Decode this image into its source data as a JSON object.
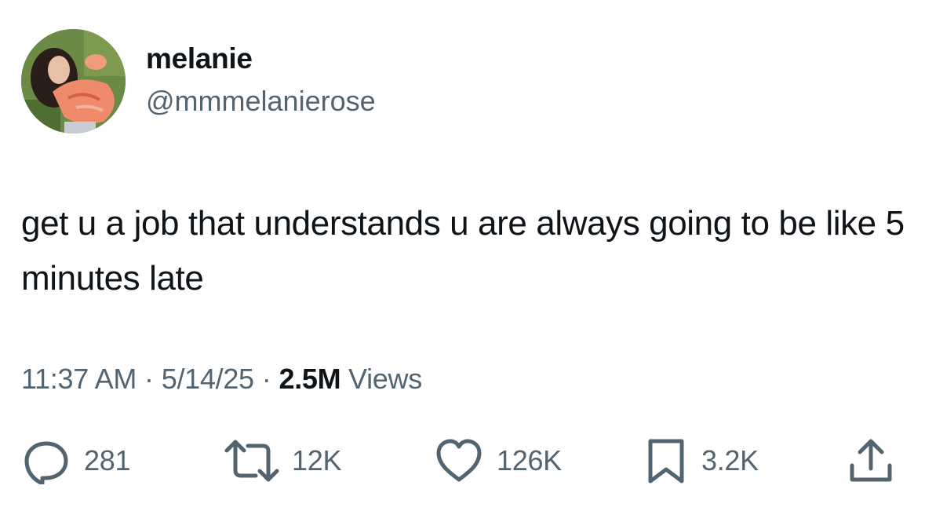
{
  "author": {
    "name": "melanie",
    "handle": "@mmmelanierose"
  },
  "tweet": {
    "text": "get u a job that understands u are always going to be like 5 minutes late"
  },
  "meta": {
    "time": "11:37 AM",
    "separator": "·",
    "date": "5/14/25",
    "views_count": "2.5M",
    "views_label": "Views"
  },
  "actions": {
    "replies": "281",
    "retweets": "12K",
    "likes": "126K",
    "bookmarks": "3.2K"
  },
  "colors": {
    "text_primary": "#0f1419",
    "text_secondary": "#536471",
    "background": "#ffffff"
  },
  "icons": {
    "reply": "reply-icon",
    "retweet": "retweet-icon",
    "like": "heart-icon",
    "bookmark": "bookmark-icon",
    "share": "share-icon"
  }
}
